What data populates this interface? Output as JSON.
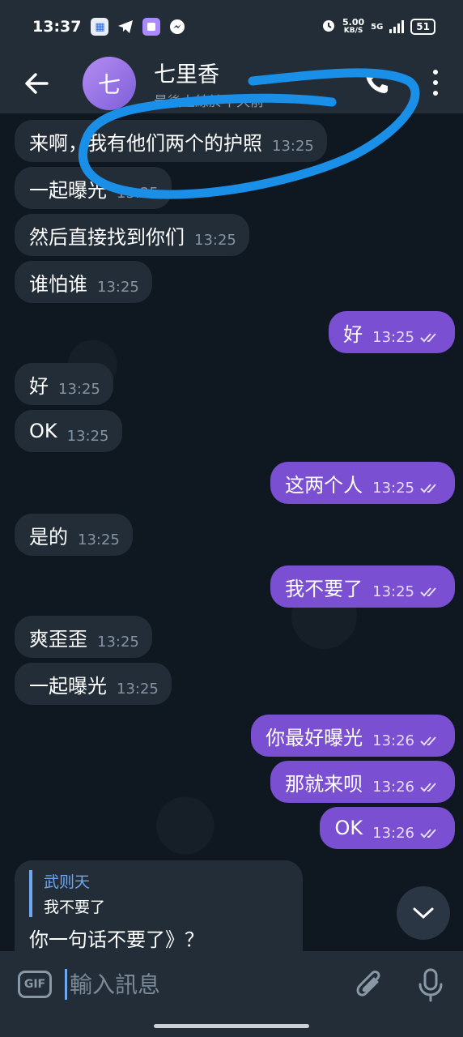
{
  "status_bar": {
    "time": "13:37",
    "speed": "5.00",
    "speed_unit": "KB/S",
    "network": "5G",
    "battery": "51",
    "app_icons": [
      "app-icon",
      "telegram-icon",
      "gallery-icon",
      "messenger-icon"
    ]
  },
  "header": {
    "back_icon": "arrow-left-icon",
    "avatar_letter": "七",
    "title": "七里香",
    "subtitle": "最後上線於不久前"
  },
  "messages": [
    {
      "text": "来啊，我有他们两个的护照",
      "time": "13:25",
      "dir": "in"
    },
    {
      "text": "一起曝光",
      "time": "13:25",
      "dir": "in"
    },
    {
      "text": "然后直接找到你们",
      "time": "13:25",
      "dir": "in"
    },
    {
      "text": "谁怕谁",
      "time": "13:25",
      "dir": "in"
    },
    {
      "text": "好",
      "time": "13:25",
      "dir": "out"
    },
    {
      "text": "好",
      "time": "13:25",
      "dir": "in"
    },
    {
      "text": "OK",
      "time": "13:25",
      "dir": "in"
    },
    {
      "text": "这两个人",
      "time": "13:25",
      "dir": "out"
    },
    {
      "text": "是的",
      "time": "13:25",
      "dir": "in"
    },
    {
      "text": "我不要了",
      "time": "13:25",
      "dir": "out"
    },
    {
      "text": "爽歪歪",
      "time": "13:25",
      "dir": "in"
    },
    {
      "text": "一起曝光",
      "time": "13:25",
      "dir": "in"
    },
    {
      "text": "你最好曝光",
      "time": "13:26",
      "dir": "out"
    },
    {
      "text": "那就来呗",
      "time": "13:26",
      "dir": "out"
    },
    {
      "text": "OK",
      "time": "13:26",
      "dir": "out"
    }
  ],
  "reply": {
    "author": "武则天",
    "quoted": "我不要了",
    "text": "你一句话不要了》？"
  },
  "input": {
    "gif_label": "GIF",
    "placeholder": "輸入訊息",
    "value": ""
  },
  "colors": {
    "outgoing": "#7b4fd1",
    "incoming": "#222d38",
    "highlight": "#1a8fe8",
    "accent": "#6ea8f0"
  }
}
